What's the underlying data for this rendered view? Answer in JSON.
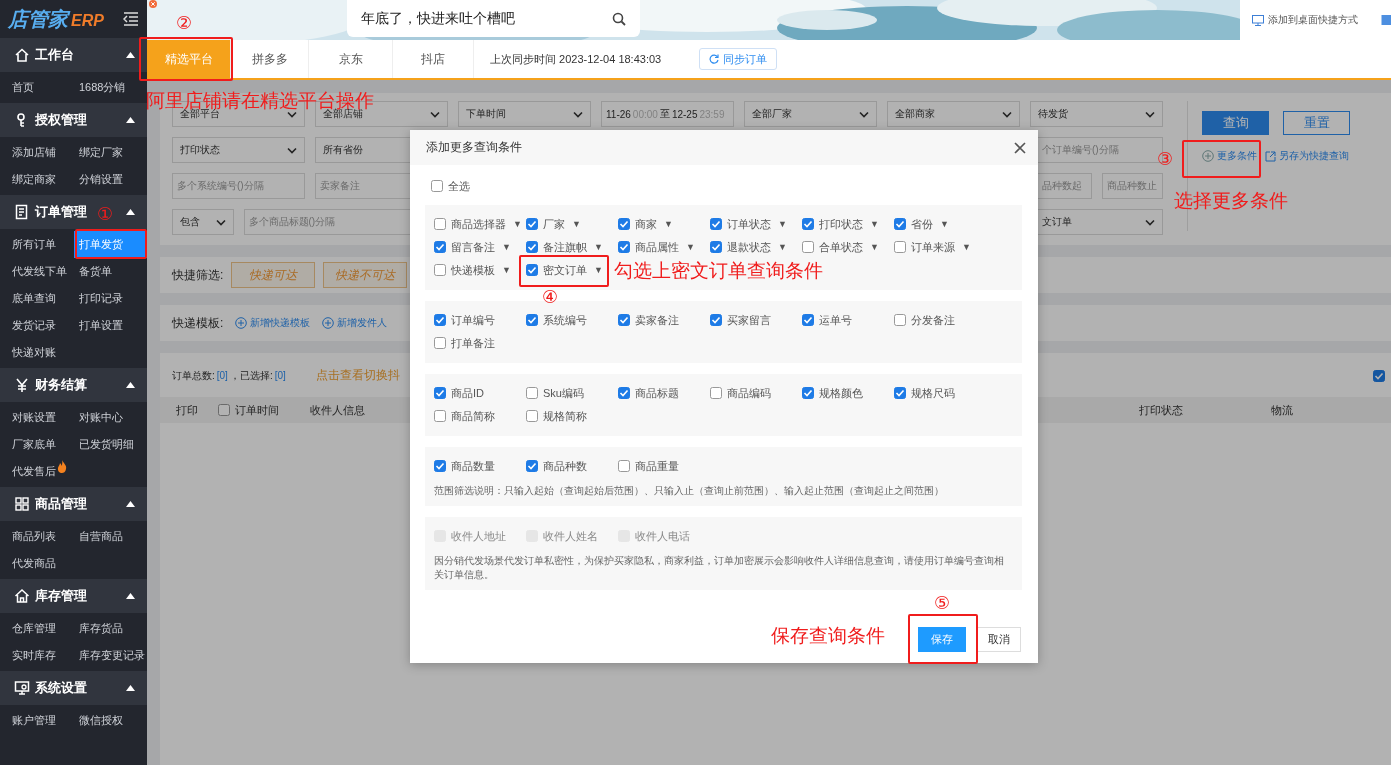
{
  "sidebar": {
    "logo": {
      "name": "店管家",
      "suffix": "ERP"
    },
    "groups": [
      {
        "title": "工作台",
        "expanded": true,
        "items": [
          {
            "label": "首页",
            "selected": false,
            "hot": false
          },
          {
            "label": "1688分销",
            "selected": false,
            "hot": false
          }
        ]
      },
      {
        "title": "授权管理",
        "expanded": true,
        "items": [
          {
            "label": "添加店铺",
            "selected": false,
            "hot": false
          },
          {
            "label": "绑定厂家",
            "selected": false,
            "hot": false
          },
          {
            "label": "绑定商家",
            "selected": false,
            "hot": false
          },
          {
            "label": "分销设置",
            "selected": false,
            "hot": false
          }
        ]
      },
      {
        "title": "订单管理",
        "expanded": true,
        "items": [
          {
            "label": "所有订单",
            "selected": false,
            "hot": false
          },
          {
            "label": "打单发货",
            "selected": true,
            "hot": false
          },
          {
            "label": "代发线下单",
            "selected": false,
            "hot": false
          },
          {
            "label": "备货单",
            "selected": false,
            "hot": false
          },
          {
            "label": "底单查询",
            "selected": false,
            "hot": false
          },
          {
            "label": "打印记录",
            "selected": false,
            "hot": false
          },
          {
            "label": "发货记录",
            "selected": false,
            "hot": false
          },
          {
            "label": "打单设置",
            "selected": false,
            "hot": false
          },
          {
            "label": "快递对账",
            "selected": false,
            "hot": false
          }
        ]
      },
      {
        "title": "财务结算",
        "expanded": true,
        "items": [
          {
            "label": "对账设置",
            "selected": false,
            "hot": false
          },
          {
            "label": "对账中心",
            "selected": false,
            "hot": false
          },
          {
            "label": "厂家底单",
            "selected": false,
            "hot": false
          },
          {
            "label": "已发货明细",
            "selected": false,
            "hot": false
          },
          {
            "label": "代发售后",
            "selected": false,
            "hot": true
          }
        ]
      },
      {
        "title": "商品管理",
        "expanded": true,
        "items": [
          {
            "label": "商品列表",
            "selected": false,
            "hot": false
          },
          {
            "label": "自营商品",
            "selected": false,
            "hot": false
          },
          {
            "label": "代发商品",
            "selected": false,
            "hot": false
          }
        ]
      },
      {
        "title": "库存管理",
        "expanded": true,
        "items": [
          {
            "label": "仓库管理",
            "selected": false,
            "hot": false
          },
          {
            "label": "库存货品",
            "selected": false,
            "hot": false
          },
          {
            "label": "实时库存",
            "selected": false,
            "hot": false
          },
          {
            "label": "库存变更记录",
            "selected": false,
            "hot": false
          }
        ]
      },
      {
        "title": "系统设置",
        "expanded": true,
        "items": [
          {
            "label": "账户管理",
            "selected": false,
            "hot": false
          },
          {
            "label": "微信授权",
            "selected": false,
            "hot": false
          }
        ]
      }
    ]
  },
  "banner": {
    "kind": "picture",
    "search": {
      "value": "年底了，快进来吐个槽吧"
    },
    "shortcut": "添加到桌面快捷方式"
  },
  "platform_tabs": [
    {
      "label": "精选平台",
      "selected": true
    },
    {
      "label": "拼多多",
      "selected": false
    },
    {
      "label": "京东",
      "selected": false
    },
    {
      "label": "抖店",
      "selected": false
    }
  ],
  "sync": {
    "text": "上次同步时间 2023-12-04 18:43:03",
    "button": "同步订单"
  },
  "filters": {
    "rows": [
      [
        {
          "kind": "select",
          "value": "全部平台"
        },
        {
          "kind": "select",
          "value": "全部店铺"
        },
        {
          "kind": "select",
          "value": "下单时间"
        },
        {
          "kind": "date_range",
          "start_date": "11-26",
          "start_time": "00:00",
          "sep": "至",
          "end_date": "12-25",
          "end_time": "23:59"
        },
        {
          "kind": "select",
          "value": "全部厂家"
        },
        {
          "kind": "select",
          "value": "全部商家"
        },
        {
          "kind": "select",
          "value": "待发货"
        }
      ],
      [
        {
          "kind": "select",
          "value": "打印状态"
        },
        {
          "kind": "select",
          "value": "所有省份"
        },
        {
          "kind": "input",
          "placeholder": "个订单编号()分隔"
        }
      ],
      [
        {
          "kind": "input",
          "placeholder": "多个系统编号()分隔"
        },
        {
          "kind": "input",
          "placeholder": "卖家备注"
        },
        {
          "kind": "input",
          "placeholder": "品种数起"
        },
        {
          "kind": "input",
          "placeholder": "商品种数止"
        }
      ],
      [
        {
          "kind": "select",
          "value": "包含"
        },
        {
          "kind": "input",
          "placeholder": "多个商品标题()分隔"
        },
        {
          "kind": "select",
          "value": "文订单"
        }
      ]
    ],
    "search_button": "查询",
    "reset_button": "重置",
    "more_link": "更多条件",
    "save_link": "另存为快捷查询"
  },
  "quick_filter": {
    "label": "快捷筛选:",
    "buttons": [
      "快递可达",
      "快递不可达"
    ]
  },
  "templates": {
    "label": "快递模板:",
    "links": [
      "新增快递模板",
      "新增发件人"
    ]
  },
  "orders": {
    "total_label": "订单总数:",
    "total": "[0]",
    "selected_label": "，已选择:",
    "selected_count": "[0]",
    "notice": "点击查看切换抖",
    "toggle": {
      "checked": true
    },
    "header_checkbox": {
      "checked": false
    },
    "columns": [
      "打印",
      "订单时间",
      "收件人信息",
      "打印状态",
      "物流"
    ]
  },
  "modal": {
    "title": "添加更多查询条件",
    "select_all": {
      "label": "全选",
      "checked": false
    },
    "sections": [
      {
        "items": [
          {
            "label": "商品选择器",
            "checked": false,
            "arrow": "▼"
          },
          {
            "label": "厂家",
            "checked": true,
            "arrow": "▼"
          },
          {
            "label": "商家",
            "checked": true,
            "arrow": "▼"
          },
          {
            "label": "订单状态",
            "checked": true,
            "arrow": "▼"
          },
          {
            "label": "打印状态",
            "checked": true,
            "arrow": "▼"
          },
          {
            "label": "省份",
            "checked": true,
            "arrow": "▼"
          },
          {
            "label": "留言备注",
            "checked": true,
            "arrow": "▼"
          },
          {
            "label": "备注旗帜",
            "checked": true,
            "arrow": "▼"
          },
          {
            "label": "商品属性",
            "checked": true,
            "arrow": "▼"
          },
          {
            "label": "退款状态",
            "checked": true,
            "arrow": "▼"
          },
          {
            "label": "合单状态",
            "checked": false,
            "arrow": "▼"
          },
          {
            "label": "订单来源",
            "checked": false,
            "arrow": "▼"
          },
          {
            "label": "快递模板",
            "checked": false,
            "arrow": "▼"
          },
          {
            "label": "密文订单",
            "checked": true,
            "arrow": "▼"
          }
        ]
      },
      {
        "items": [
          {
            "label": "订单编号",
            "checked": true
          },
          {
            "label": "系统编号",
            "checked": true
          },
          {
            "label": "卖家备注",
            "checked": true
          },
          {
            "label": "买家留言",
            "checked": true
          },
          {
            "label": "运单号",
            "checked": true
          },
          {
            "label": "分发备注",
            "checked": false
          },
          {
            "label": "打单备注",
            "checked": false
          }
        ]
      },
      {
        "items": [
          {
            "label": "商品ID",
            "checked": true
          },
          {
            "label": "Sku编码",
            "checked": false
          },
          {
            "label": "商品标题",
            "checked": true
          },
          {
            "label": "商品编码",
            "checked": false
          },
          {
            "label": "规格颜色",
            "checked": true
          },
          {
            "label": "规格尺码",
            "checked": true
          },
          {
            "label": "商品简称",
            "checked": false
          },
          {
            "label": "规格简称",
            "checked": false
          }
        ]
      },
      {
        "items": [
          {
            "label": "商品数量",
            "checked": true
          },
          {
            "label": "商品种数",
            "checked": true
          },
          {
            "label": "商品重量",
            "checked": false
          }
        ],
        "note": "范围筛选说明：只输入起始（查询起始后范围）、只输入止（查询止前范围）、输入起止范围（查询起止之间范围）"
      },
      {
        "items": [
          {
            "label": "收件人地址",
            "checked": false,
            "disabled": true
          },
          {
            "label": "收件人姓名",
            "checked": false,
            "disabled": true
          },
          {
            "label": "收件人电话",
            "checked": false,
            "disabled": true
          }
        ],
        "note": "因分销代发场景代发订单私密性，为保护买家隐私，商家利益，订单加密展示会影响收件人详细信息查询，请使用订单编号查询相关订单信息。"
      }
    ],
    "buttons": [
      {
        "label": "保存",
        "kind": "primary"
      },
      {
        "label": "取消",
        "kind": "default"
      }
    ]
  },
  "annotations": [
    {
      "number": "①"
    },
    {
      "number": "②",
      "note": "阿里店铺请在精选平台操作"
    },
    {
      "number": "③",
      "note": "选择更多条件"
    },
    {
      "number": "④",
      "note": "勾选上密文订单查询条件"
    },
    {
      "number": "⑤",
      "note": "保存查询条件"
    }
  ]
}
